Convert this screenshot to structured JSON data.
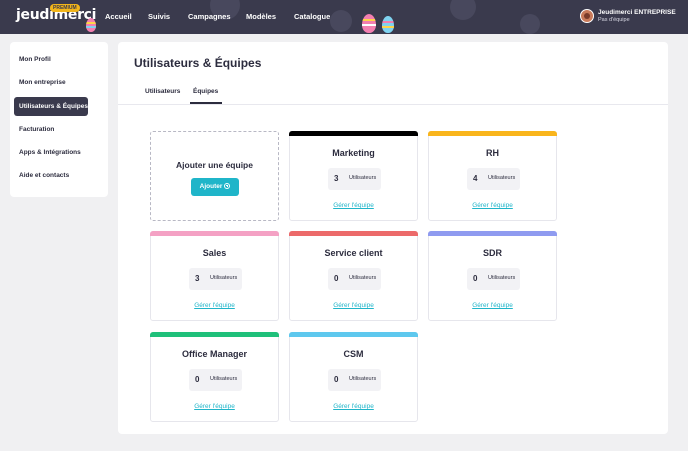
{
  "brand": {
    "logo": "jeudimerci",
    "badge": "PREMIUM"
  },
  "nav": {
    "items": [
      {
        "label": "Accueil"
      },
      {
        "label": "Suivis"
      },
      {
        "label": "Campagnes"
      },
      {
        "label": "Modèles"
      },
      {
        "label": "Catalogue"
      }
    ]
  },
  "user": {
    "name": "Jeudimerci ENTREPRISE",
    "team": "Pas d'équipe"
  },
  "sidebar": {
    "items": [
      {
        "label": "Mon Profil"
      },
      {
        "label": "Mon entreprise"
      },
      {
        "label": "Utilisateurs & Équipes",
        "active": true
      },
      {
        "label": "Facturation"
      },
      {
        "label": "Apps & Intégrations"
      },
      {
        "label": "Aide et contacts"
      }
    ]
  },
  "page": {
    "title": "Utilisateurs & Équipes",
    "tabs": [
      {
        "label": "Utilisateurs"
      },
      {
        "label": "Équipes",
        "active": true
      }
    ]
  },
  "add_team": {
    "title": "Ajouter une équipe",
    "button": "Ajouter"
  },
  "teams": [
    {
      "name": "Marketing",
      "count": "3",
      "unit": "Utilisateurs",
      "manage": "Gérer l'équipe",
      "color": "#000000"
    },
    {
      "name": "RH",
      "count": "4",
      "unit": "Utilisateurs",
      "manage": "Gérer l'équipe",
      "color": "#f9b51c"
    },
    {
      "name": "Sales",
      "count": "3",
      "unit": "Utilisateurs",
      "manage": "Gérer l'équipe",
      "color": "#f4a1c4"
    },
    {
      "name": "Service client",
      "count": "0",
      "unit": "Utilisateurs",
      "manage": "Gérer l'équipe",
      "color": "#ec6a6a"
    },
    {
      "name": "SDR",
      "count": "0",
      "unit": "Utilisateurs",
      "manage": "Gérer l'équipe",
      "color": "#8f9bf0"
    },
    {
      "name": "Office Manager",
      "count": "0",
      "unit": "Utilisateurs",
      "manage": "Gérer l'équipe",
      "color": "#1fc07a"
    },
    {
      "name": "CSM",
      "count": "0",
      "unit": "Utilisateurs",
      "manage": "Gérer l'équipe",
      "color": "#5ec8ee"
    }
  ],
  "colors": {
    "topbar": "#3a3a4d",
    "accent": "#1fb5c9"
  }
}
